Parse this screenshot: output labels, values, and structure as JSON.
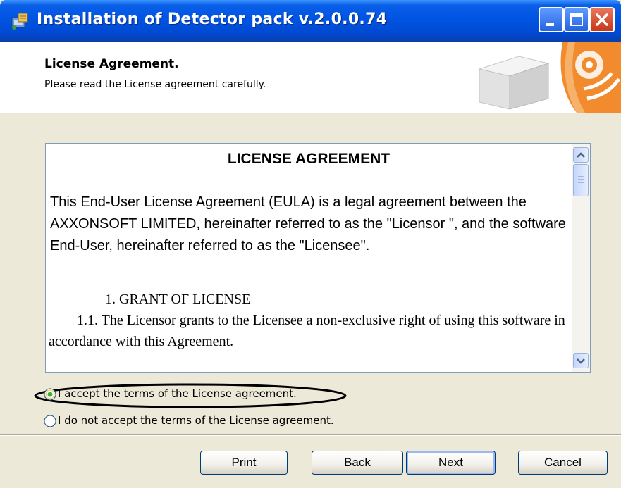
{
  "window": {
    "title": "Installation of Detector pack v.2.0.0.74",
    "title_icon": "installer-icon",
    "controls": [
      "minimize-icon",
      "maximize-icon",
      "close-icon"
    ]
  },
  "header": {
    "title": "License Agreement.",
    "subtitle": "Please read the License agreement carefully."
  },
  "license": {
    "heading": "LICENSE AGREEMENT",
    "paragraph": "This End-User License Agreement (EULA) is a legal agreement between the AXXONSOFT LIMITED, hereinafter referred to as the \"Licensor \", and the software End-User, hereinafter referred to as the \"Licensee\".",
    "grant": "1. GRANT OF LICENSE",
    "clause": "1.1. The Licensor grants to the Licensee a non-exclusive right of using this software in accordance with this Agreement."
  },
  "options": {
    "accept": "I accept the terms of the License agreement.",
    "decline": "I do not accept the terms of the License agreement.",
    "selected": "accept"
  },
  "buttons": {
    "print": "Print",
    "back": "Back",
    "next": "Next",
    "cancel": "Cancel"
  },
  "colors": {
    "titlebar": "#0054E3",
    "dialog_bg": "#ECE9D8",
    "radio_selected": "#3CB23C",
    "button_border": "#003C74"
  }
}
